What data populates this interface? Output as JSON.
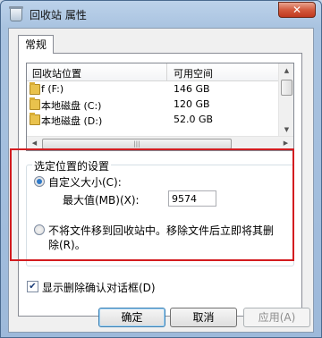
{
  "window": {
    "title": "回收站 属性",
    "close_glyph": "✕"
  },
  "tabs": [
    {
      "label": "常规"
    }
  ],
  "list": {
    "columns": [
      "回收站位置",
      "可用空间"
    ],
    "rows": [
      {
        "name": "f (F:)",
        "space": "146 GB"
      },
      {
        "name": "本地磁盘 (C:)",
        "space": "120 GB"
      },
      {
        "name": "本地磁盘 (D:)",
        "space": "52.0 GB"
      }
    ]
  },
  "settings": {
    "legend": "选定位置的设置",
    "custom_size_label": "自定义大小(C):",
    "max_size_label": "最大值(MB)(X):",
    "max_size_value": "9574",
    "no_move_label_line1": "不将文件移到回收站中。移除文件后立即将其删",
    "no_move_label_line2": "除(R)。"
  },
  "confirm_dialog_label": "显示删除确认对话框(D)",
  "buttons": {
    "ok": "确定",
    "cancel": "取消",
    "apply": "应用(A)"
  },
  "colors": {
    "highlight": "#d31c20",
    "accent": "#2f79c8"
  }
}
